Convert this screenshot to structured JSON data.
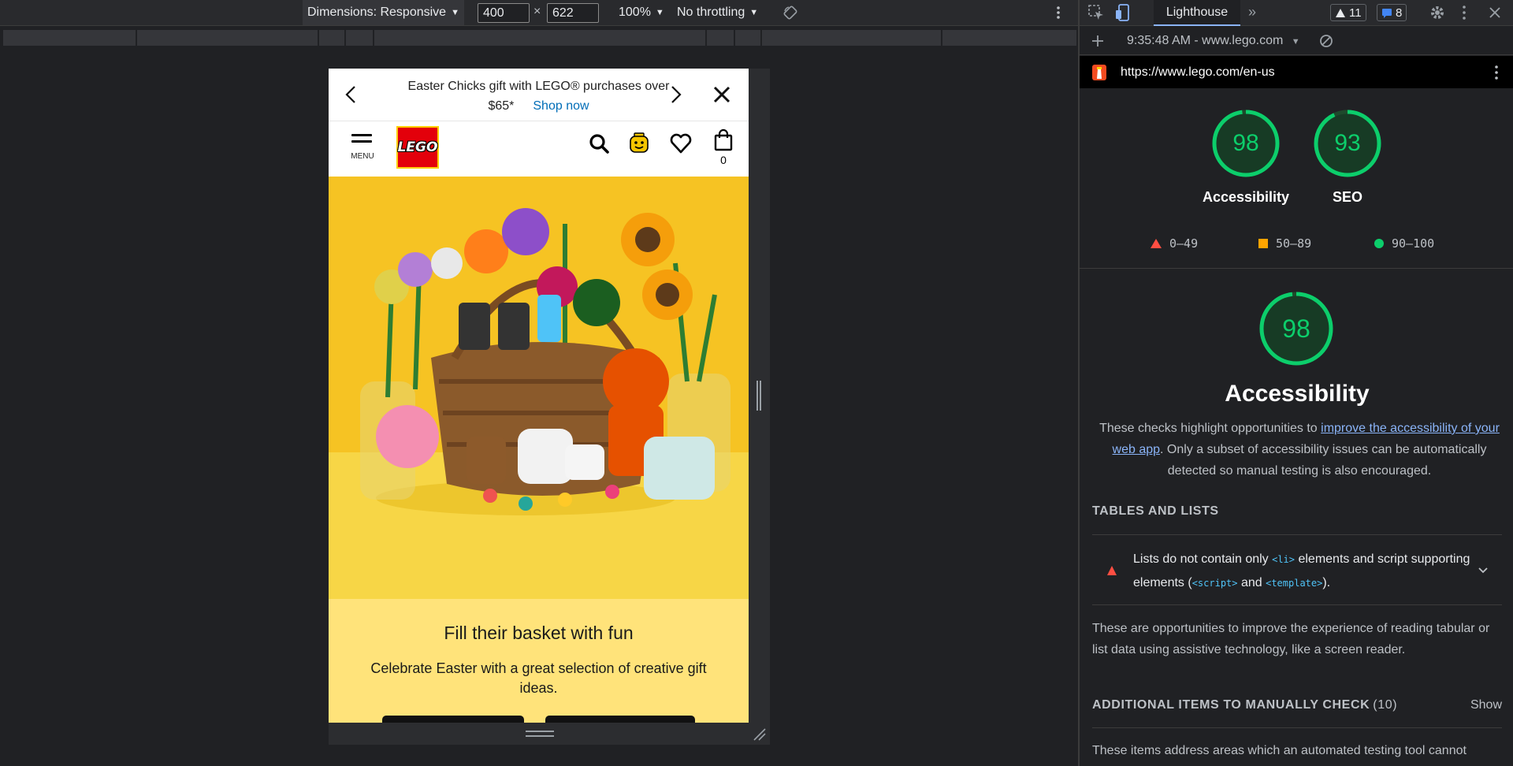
{
  "emulation_toolbar": {
    "dimensions_label": "Dimensions: Responsive",
    "width": "400",
    "times": "×",
    "height": "622",
    "zoom": "100%",
    "throttling": "No throttling"
  },
  "site": {
    "promo": {
      "text": "Easter Chicks gift with LEGO® purchases over $65*",
      "link": "Shop now"
    },
    "header": {
      "menu_label": "MENU",
      "logo_text": "LEGO",
      "cart_count": "0"
    },
    "panel": {
      "title": "Fill their basket with fun",
      "body": "Celebrate Easter with a great selection of creative gift ideas."
    }
  },
  "devtools": {
    "tab": "Lighthouse",
    "warnings_count": "11",
    "messages_count": "8",
    "report_label": "9:35:48 AM - www.lego.com",
    "url": "https://www.lego.com/en-us",
    "gauges": [
      {
        "label": "Accessibility",
        "score": "98",
        "value": 0.98
      },
      {
        "label": "SEO",
        "score": "93",
        "value": 0.93
      }
    ],
    "legend": [
      {
        "range": "0–49",
        "color": "#ff4e42"
      },
      {
        "range": "50–89",
        "color": "#ffa400"
      },
      {
        "range": "90–100",
        "color": "#0cce6b"
      }
    ],
    "category": {
      "score": "98",
      "value": 0.98,
      "title": "Accessibility",
      "desc_before": "These checks highlight opportunities to ",
      "desc_link": "improve the accessibility of your web app",
      "desc_after": ". Only a subset of accessibility issues can be automatically detected so manual testing is also encouraged."
    },
    "group_title": "TABLES AND LISTS",
    "audit": {
      "t1": "Lists do not contain only ",
      "c1": "<li>",
      "t2": " elements and script supporting elements (",
      "c2": "<script>",
      "t3": " and ",
      "c3": "<template>",
      "t4": ")."
    },
    "group_desc": "These are opportunities to improve the experience of reading tabular or list data using assistive technology, like a screen reader.",
    "manual": {
      "title": "ADDITIONAL ITEMS TO MANUALLY CHECK",
      "count": "(10)",
      "show": "Show",
      "desc": "These items address areas which an automated testing tool cannot"
    }
  }
}
